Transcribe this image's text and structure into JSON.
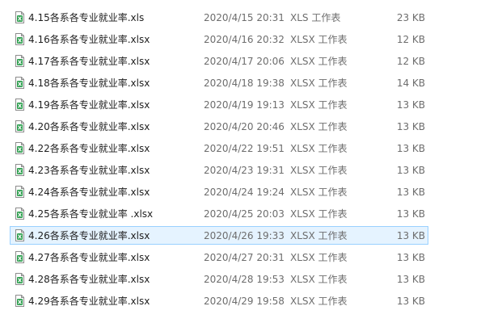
{
  "files": [
    {
      "name": "4.15各系各专业就业率.xls",
      "date": "2020/4/15 20:31",
      "type": "XLS 工作表",
      "size": "23 KB",
      "selected": false
    },
    {
      "name": "4.16各系各专业就业率.xlsx",
      "date": "2020/4/16 20:32",
      "type": "XLSX 工作表",
      "size": "12 KB",
      "selected": false
    },
    {
      "name": "4.17各系各专业就业率.xlsx",
      "date": "2020/4/17 20:06",
      "type": "XLSX 工作表",
      "size": "12 KB",
      "selected": false
    },
    {
      "name": "4.18各系各专业就业率.xlsx",
      "date": "2020/4/18 19:38",
      "type": "XLSX 工作表",
      "size": "14 KB",
      "selected": false
    },
    {
      "name": "4.19各系各专业就业率.xlsx",
      "date": "2020/4/19 19:13",
      "type": "XLSX 工作表",
      "size": "13 KB",
      "selected": false
    },
    {
      "name": "4.20各系各专业就业率.xlsx",
      "date": "2020/4/20 20:46",
      "type": "XLSX 工作表",
      "size": "13 KB",
      "selected": false
    },
    {
      "name": "4.22各系各专业就业率.xlsx",
      "date": "2020/4/22 19:51",
      "type": "XLSX 工作表",
      "size": "13 KB",
      "selected": false
    },
    {
      "name": "4.23各系各专业就业率.xlsx",
      "date": "2020/4/23 19:31",
      "type": "XLSX 工作表",
      "size": "13 KB",
      "selected": false
    },
    {
      "name": "4.24各系各专业就业率.xlsx",
      "date": "2020/4/24 19:24",
      "type": "XLSX 工作表",
      "size": "13 KB",
      "selected": false
    },
    {
      "name": "4.25各系各专业就业率 .xlsx",
      "date": "2020/4/25 20:03",
      "type": "XLSX 工作表",
      "size": "13 KB",
      "selected": false
    },
    {
      "name": "4.26各系各专业就业率.xlsx",
      "date": "2020/4/26 19:33",
      "type": "XLSX 工作表",
      "size": "13 KB",
      "selected": true
    },
    {
      "name": "4.27各系各专业就业率.xlsx",
      "date": "2020/4/27 20:31",
      "type": "XLSX 工作表",
      "size": "13 KB",
      "selected": false
    },
    {
      "name": "4.28各系各专业就业率.xlsx",
      "date": "2020/4/28 19:53",
      "type": "XLSX 工作表",
      "size": "13 KB",
      "selected": false
    },
    {
      "name": "4.29各系各专业就业率.xlsx",
      "date": "2020/4/29 19:58",
      "type": "XLSX 工作表",
      "size": "13 KB",
      "selected": false
    }
  ],
  "colors": {
    "icon_sheet": "#ffffff",
    "icon_border": "#8c8c8c",
    "icon_badge": "#2e9e4f",
    "selection_bg": "#e5f3ff",
    "selection_border": "#99d1ff"
  },
  "icon": "excel-file-icon"
}
